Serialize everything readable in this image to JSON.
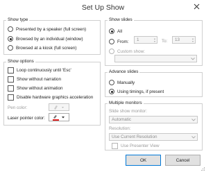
{
  "window": {
    "title": "Set Up Show"
  },
  "show_type": {
    "legend": "Show type",
    "options": [
      {
        "label": "Presented by a speaker (full screen)",
        "checked": false
      },
      {
        "label": "Browsed by an individual (window)",
        "checked": true
      },
      {
        "label": "Browsed at a kiosk (full screen)",
        "checked": false
      }
    ]
  },
  "show_options": {
    "legend": "Show options",
    "checkboxes": [
      {
        "label": "Loop continuously until 'Esc'"
      },
      {
        "label": "Show without narration"
      },
      {
        "label": "Show without animation"
      },
      {
        "label": "Disable hardware graphics acceleration"
      }
    ],
    "pen_color_label": "Pen color:",
    "laser_pointer_label": "Laser pointer color:",
    "laser_color": "#e02020"
  },
  "show_slides": {
    "legend": "Show slides",
    "all_label": "All",
    "from_label": "From:",
    "from_value": "1",
    "to_label": "To:",
    "to_value": "13",
    "custom_label": "Custom show:"
  },
  "advance_slides": {
    "legend": "Advance slides",
    "manually_label": "Manually",
    "timings_label": "Using timings, if present"
  },
  "multiple_monitors": {
    "legend": "Multiple monitors",
    "monitor_label": "Slide show monitor:",
    "monitor_value": "Automatic",
    "resolution_label": "Resolution:",
    "resolution_value": "Use Current Resolution",
    "presenter_view_label": "Use Presenter View"
  },
  "buttons": {
    "ok": "OK",
    "cancel": "Cancel"
  },
  "colors": {
    "accent": "#0078d7",
    "border": "#cfcfcf"
  }
}
